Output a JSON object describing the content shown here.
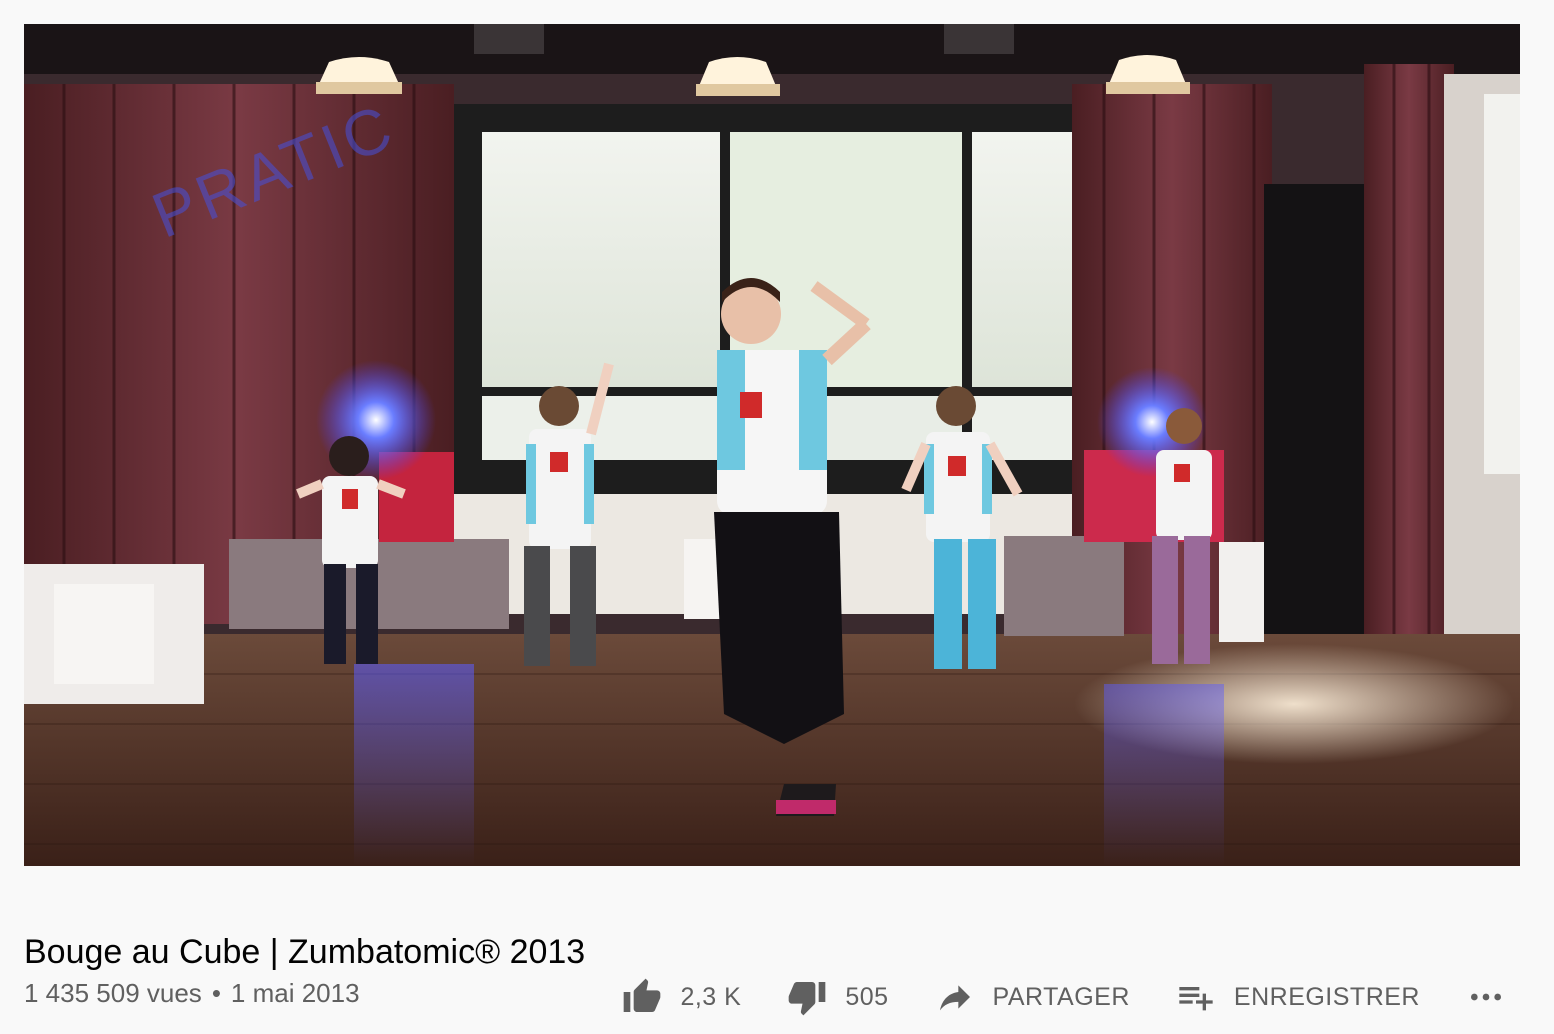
{
  "video": {
    "watermark": "PRATIC",
    "title": "Bouge au Cube | Zumbatomic® 2013",
    "views": "1 435 509 vues",
    "separator": "•",
    "date": "1 mai 2013"
  },
  "actions": {
    "like_count": "2,3 K",
    "dislike_count": "505",
    "share_label": "PARTAGER",
    "save_label": "ENREGISTRER"
  },
  "icons": {
    "like": "thumb-up-icon",
    "dislike": "thumb-down-icon",
    "share": "share-icon",
    "save": "playlist-add-icon",
    "more": "more-horizontal-icon"
  }
}
